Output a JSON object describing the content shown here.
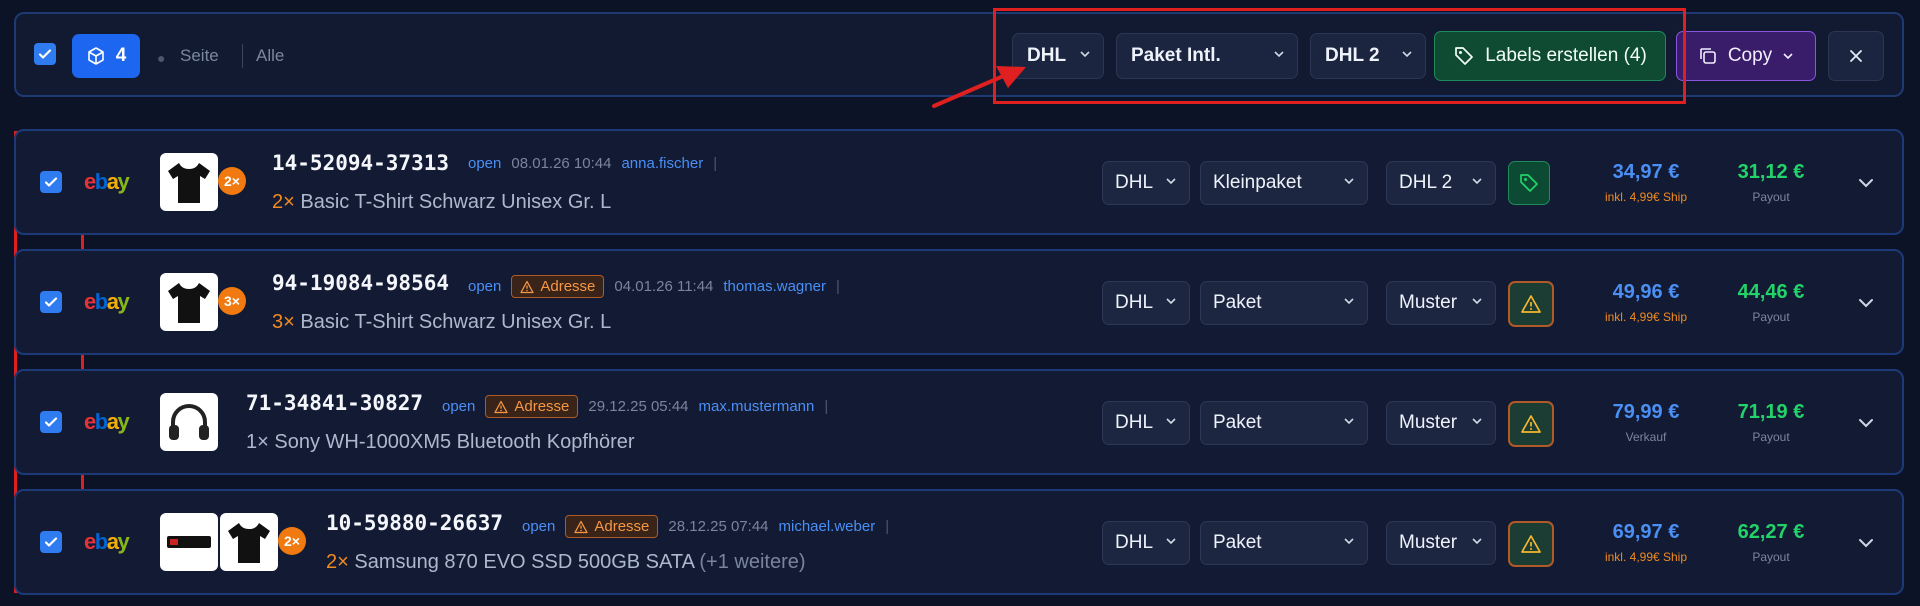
{
  "bulkbar": {
    "selected_count": "4",
    "seite_label": "Seite",
    "alle_label": "Alle",
    "carrier": "DHL",
    "product": "Paket Intl.",
    "account": "DHL 2",
    "labels_button": "Labels erstellen (4)",
    "copy_button": "Copy"
  },
  "orders": [
    {
      "order_no": "14-52094-37313",
      "status": "open",
      "warning": "",
      "date": "08.01.26 10:44",
      "user": "anna.fischer",
      "qty_badge": "2×",
      "item_qty": "2×",
      "item_name": "Basic T-Shirt Schwarz Unisex Gr. L",
      "item_more": "",
      "carrier": "DHL",
      "product": "Kleinpaket",
      "account": "DHL 2",
      "action_icon": "tag-icon",
      "price": "34,97 €",
      "price_sub": "inkl. 4,99€ Ship",
      "payout": "31,12 €",
      "payout_label": "Payout"
    },
    {
      "order_no": "94-19084-98564",
      "status": "open",
      "warning": "Adresse",
      "date": "04.01.26 11:44",
      "user": "thomas.wagner",
      "qty_badge": "3×",
      "item_qty": "3×",
      "item_name": "Basic T-Shirt Schwarz Unisex Gr. L",
      "item_more": "",
      "carrier": "DHL",
      "product": "Paket",
      "account": "Muster",
      "action_icon": "warning-icon",
      "price": "49,96 €",
      "price_sub": "inkl. 4,99€ Ship",
      "payout": "44,46 €",
      "payout_label": "Payout"
    },
    {
      "order_no": "71-34841-30827",
      "status": "open",
      "warning": "Adresse",
      "date": "29.12.25 05:44",
      "user": "max.mustermann",
      "qty_badge": "",
      "item_qty": "1×",
      "item_name": "Sony WH-1000XM5 Bluetooth Kopfhörer",
      "item_more": "",
      "carrier": "DHL",
      "product": "Paket",
      "account": "Muster",
      "action_icon": "warning-icon",
      "price": "79,99 €",
      "price_sub": "Verkauf",
      "payout": "71,19 €",
      "payout_label": "Payout"
    },
    {
      "order_no": "10-59880-26637",
      "status": "open",
      "warning": "Adresse",
      "date": "28.12.25 07:44",
      "user": "michael.weber",
      "qty_badge": "2×",
      "item_qty": "2×",
      "item_name": "Samsung 870 EVO SSD 500GB SATA",
      "item_more": "(+1 weitere)",
      "carrier": "DHL",
      "product": "Paket",
      "account": "Muster",
      "action_icon": "warning-icon",
      "price": "69,97 €",
      "price_sub": "inkl. 4,99€ Ship",
      "payout": "62,27 €",
      "payout_label": "Payout"
    }
  ],
  "colors": {
    "background": "#0c1326",
    "accent_blue": "#1d67f0",
    "payout_green": "#22d36a",
    "warning_orange": "#f59845",
    "annotation_red": "#e02020"
  }
}
